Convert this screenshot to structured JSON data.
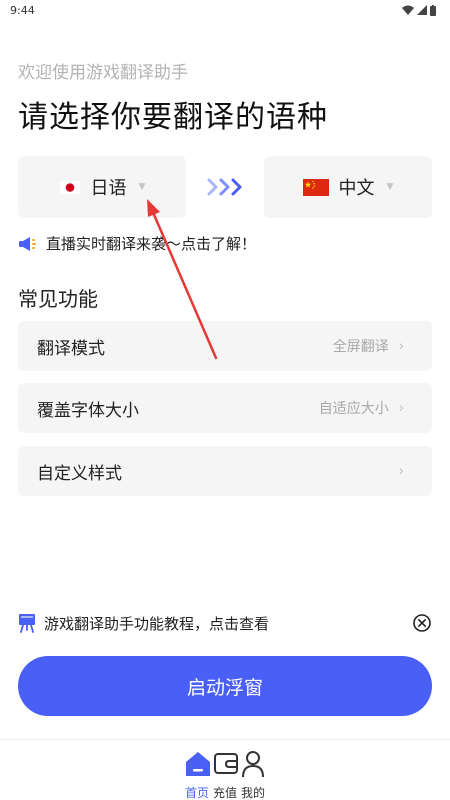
{
  "status_bar": {
    "time": "9:44"
  },
  "header": {
    "welcome": "欢迎使用游戏翻译助手",
    "headline": "请选择你要翻译的语种"
  },
  "languages": {
    "source": {
      "name": "日语",
      "flag": "japan-flag-icon"
    },
    "target": {
      "name": "中文",
      "flag": "china-flag-icon"
    }
  },
  "promo": {
    "text": "直播实时翻译来袭～点击了解！"
  },
  "features": {
    "title": "常见功能",
    "items": [
      {
        "label": "翻译模式",
        "value": "全屏翻译"
      },
      {
        "label": "覆盖字体大小",
        "value": "自适应大小"
      },
      {
        "label": "自定义样式",
        "value": ""
      }
    ]
  },
  "tutorial": {
    "text": "游戏翻译助手功能教程，点击查看"
  },
  "start_button": {
    "label": "启动浮窗"
  },
  "bottom_nav": {
    "items": [
      {
        "label": "首页",
        "icon": "home-icon",
        "active": true
      },
      {
        "label": "充值",
        "icon": "wallet-icon",
        "active": false
      },
      {
        "label": "我的",
        "icon": "profile-icon",
        "active": false
      }
    ]
  },
  "colors": {
    "accent": "#4a5ff5",
    "card_bg": "#f5f5f5",
    "annotation_arrow": "#e53935"
  }
}
